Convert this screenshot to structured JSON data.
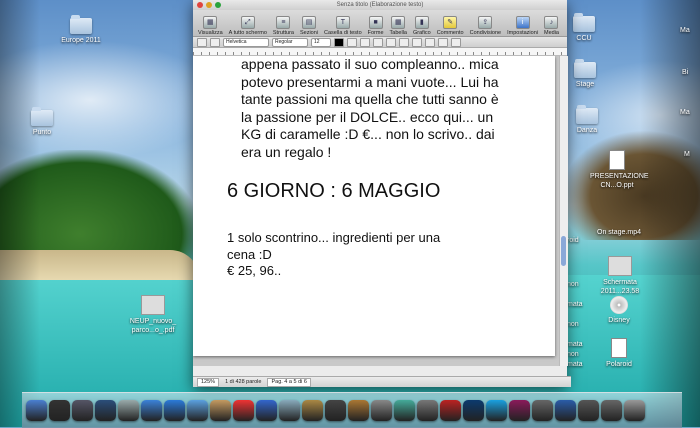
{
  "window": {
    "title": "Senza titolo (Elaborazione testo)",
    "toolbar": [
      {
        "label": "Visualizza",
        "icon": "view-icon"
      },
      {
        "label": "A tutto schermo",
        "icon": "fullscreen-icon"
      },
      {
        "label": "Struttura",
        "icon": "outline-icon"
      },
      {
        "label": "Sezioni",
        "icon": "sections-icon"
      },
      {
        "label": "Casella di testo",
        "icon": "textbox-icon"
      },
      {
        "label": "Forme",
        "icon": "shapes-icon"
      },
      {
        "label": "Tabella",
        "icon": "table-icon"
      },
      {
        "label": "Grafico",
        "icon": "chart-icon"
      },
      {
        "label": "Commento",
        "icon": "comment-icon"
      },
      {
        "label": "Condivisione",
        "icon": "share-icon"
      },
      {
        "label": "Impostazioni",
        "icon": "inspector-icon"
      },
      {
        "label": "Media",
        "icon": "media-icon"
      }
    ],
    "format": {
      "font": "Helvetica",
      "style": "Regolar",
      "size": "12"
    },
    "status": {
      "zoom": "125%",
      "words": "1 di 428 parole",
      "page": "Pag. 4 a 5 di 6"
    }
  },
  "document": {
    "para_lines": [
      "appena passato il suo compleanno.. mica",
      "potevo presentarmi a mani vuote... Lui ha",
      "tante passioni ma quella che tutti sanno è",
      "la passione per il DOLCE.. ecco qui... un",
      "KG di caramelle :D €... non lo scrivo.. dai",
      "era un regalo !"
    ],
    "heading": "6 GIORNO : 6 MAGGIO",
    "body_lines": [
      "1 solo scontrino... ingredienti per una",
      "cena :D",
      "€ 25, 96.."
    ]
  },
  "desktop": {
    "icons_left": [
      {
        "label": "Europe 2011",
        "type": "folder"
      },
      {
        "label": "Punto",
        "type": "folder"
      },
      {
        "label": "NEUP_nuovo_ parco...o_.pdf",
        "type": "document"
      }
    ],
    "icons_right": [
      {
        "label": "CCU",
        "type": "folder"
      },
      {
        "label": "Stage",
        "type": "folder"
      },
      {
        "label": "Danza",
        "type": "folder"
      },
      {
        "label": "PRESENTAZIONE CN...O.ppt",
        "type": "document"
      },
      {
        "label": "On stage.mp4",
        "type": "video"
      },
      {
        "label": "Schermata 2011...23.58",
        "type": "image"
      },
      {
        "label": "Disney",
        "type": "disc"
      },
      {
        "label": "Polaroid",
        "type": "document"
      }
    ],
    "edge_right": [
      "Ma",
      "Ma",
      "Bi",
      "M"
    ],
    "edge_left": [
      "roid",
      "non",
      "mata",
      "non",
      "mata",
      "non",
      "mata"
    ]
  },
  "dock": {
    "apps": [
      {
        "icon": "finder-icon",
        "color": "#4a7fd0"
      },
      {
        "icon": "dashboard-icon",
        "color": "#333"
      },
      {
        "icon": "launchpad-icon",
        "color": "#556"
      },
      {
        "icon": "expose-icon",
        "color": "#2b4e7a"
      },
      {
        "icon": "stack-icon",
        "color": "#9aa"
      },
      {
        "icon": "safari-icon",
        "color": "#3b82d9"
      },
      {
        "icon": "appstore-icon",
        "color": "#2b7ad9"
      },
      {
        "icon": "mail-icon",
        "color": "#5aa0e0"
      },
      {
        "icon": "contacts-icon",
        "color": "#c49a60"
      },
      {
        "icon": "calendar-icon",
        "color": "#e33"
      },
      {
        "icon": "itunes-icon",
        "color": "#3366cc"
      },
      {
        "icon": "ichat-icon",
        "color": "#8ab"
      },
      {
        "icon": "iphoto-icon",
        "color": "#aa8844"
      },
      {
        "icon": "imovie-icon",
        "color": "#444"
      },
      {
        "icon": "garageband-icon",
        "color": "#aa7733"
      },
      {
        "icon": "preview-icon",
        "color": "#888"
      },
      {
        "icon": "timemachine-icon",
        "color": "#4a9"
      },
      {
        "icon": "preferences-icon",
        "color": "#777"
      },
      {
        "icon": "photoboot-icon",
        "color": "#b22"
      },
      {
        "icon": "ps-icon",
        "color": "#0b3a6e"
      },
      {
        "icon": "skype-icon",
        "color": "#1aa0e0"
      },
      {
        "icon": "indesign-icon",
        "color": "#8b1a5a"
      },
      {
        "icon": "tool-icon",
        "color": "#666"
      },
      {
        "icon": "appstore2-icon",
        "color": "#2a5ca8"
      },
      {
        "icon": "downloads-icon",
        "color": "#555"
      },
      {
        "icon": "documents-icon",
        "color": "#666"
      },
      {
        "icon": "trash-icon",
        "color": "#999"
      }
    ]
  }
}
